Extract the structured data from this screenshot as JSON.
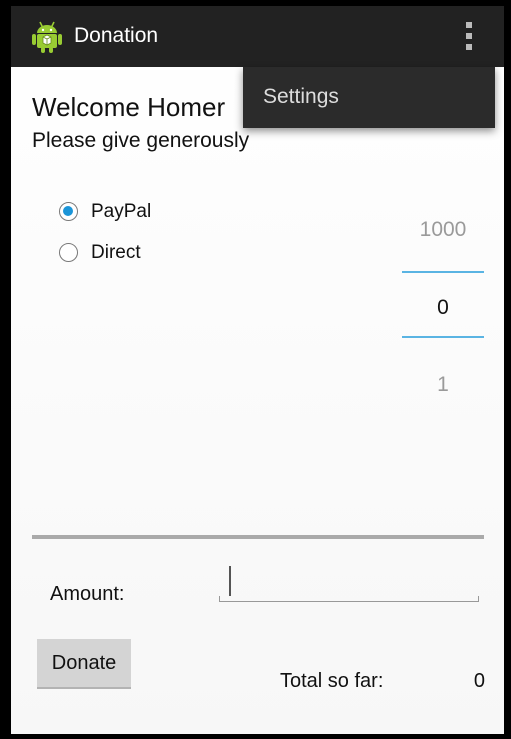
{
  "action_bar": {
    "title": "Donation",
    "app_icon": "android-icon",
    "overflow_icon": "overflow-menu-icon"
  },
  "overflow_menu": {
    "items": [
      {
        "label": "Settings"
      }
    ]
  },
  "main": {
    "welcome": "Welcome Homer",
    "subtitle": "Please give generously"
  },
  "payment_methods": [
    {
      "label": "PayPal",
      "selected": true
    },
    {
      "label": "Direct",
      "selected": false
    }
  ],
  "amount_picker": {
    "above": "1000",
    "current": "0",
    "below": "1"
  },
  "progress": {
    "value": 0
  },
  "amount": {
    "label": "Amount:",
    "value": ""
  },
  "donate_button": "Donate",
  "total": {
    "label": "Total so far:",
    "value": "0"
  },
  "colors": {
    "accent": "#1b95d8",
    "picker_divider": "#5ab4e3",
    "action_bar": "#222222"
  }
}
